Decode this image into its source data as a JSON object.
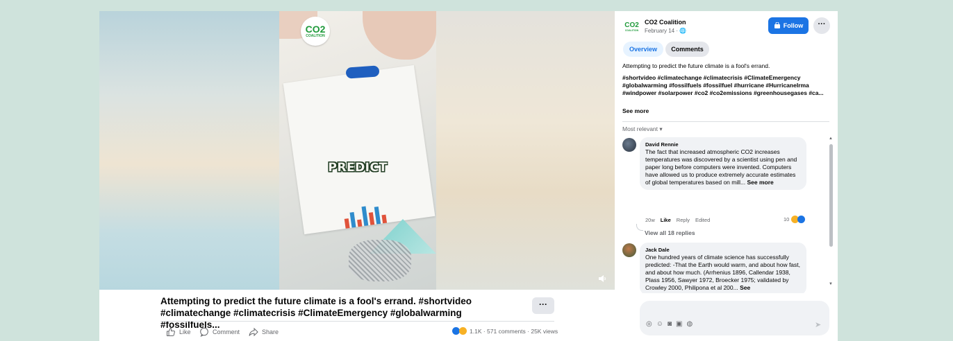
{
  "video": {
    "logo_text": "CO2",
    "logo_subtext": "COALITION",
    "overlay_text": "PREDICT",
    "volume_icon": "speaker-icon"
  },
  "post": {
    "title": "Attempting to predict the future climate is a fool's errand. #shortvideo #climatechange #climatecrisis #ClimateEmergency #globalwarming #fossilfuels...",
    "more_label": "···",
    "actions": {
      "like": "Like",
      "comment": "Comment",
      "share": "Share"
    },
    "stats": "1.1K · 571 comments · 25K views"
  },
  "panel": {
    "avatar_text": "CO2",
    "avatar_subtext": "COALITION",
    "page_name": "CO2 Coalition",
    "date": "February 14 · 🌐",
    "follow_label": "Follow",
    "more_label": "···",
    "tabs": [
      "Overview",
      "Comments"
    ],
    "description": "Attempting to predict the future climate is a fool's errand.",
    "hashtags": "#shortvideo #climatechange #climatecrisis #ClimateEmergency #globalwarming #fossilfuels #fossilfuel #hurricane #HurricaneIrma #windpower #solarpower #co2 #co2emissions #greenhousegases #ca...",
    "see_more": "See more",
    "sort_label": "Most relevant ▾"
  },
  "comments": [
    {
      "name": "David Rennie",
      "text": "The fact that increased atmospheric CO2 increases temperatures was discovered by a scientist using pen and paper long before computers were invented. Computers have allowed us to produce extremely accurate estimates of global temperatures based on mill...",
      "see_more": "See more",
      "time": "20w",
      "like": "Like",
      "reply": "Reply",
      "edited": "Edited",
      "reaction_count": "10",
      "view_replies": "View all 18 replies"
    },
    {
      "name": "Jack Dale",
      "text": "One hundred years of climate science has successfully predicted: -That the Earth would warm, and about how fast, and about how much. (Arrhenius 1896, Callendar 1938, Plass 1956, Sawyer 1972, Broecker 1975; validated by Crowley 2000, Philipona et al 200...",
      "see_more": "See"
    }
  ],
  "composer": {
    "icons": [
      "sticker-icon",
      "emoji-icon",
      "camera-icon",
      "gif-icon",
      "avatar-sticker-icon"
    ],
    "send_icon": "send-icon"
  },
  "colors": {
    "accent": "#1b74e4",
    "brand_green": "#1e9a3a",
    "background": "#cfe3dc"
  }
}
